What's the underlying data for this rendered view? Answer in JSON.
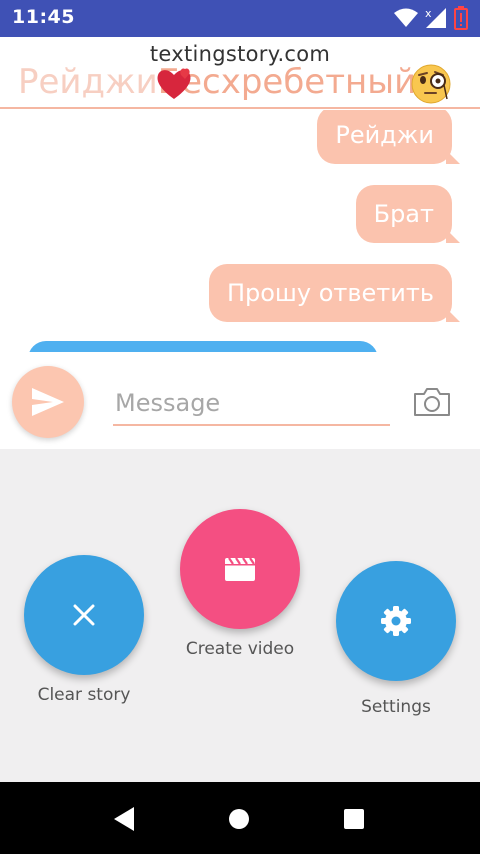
{
  "status_bar": {
    "time": "11:45"
  },
  "header": {
    "watermark": "textingstory.com",
    "name_part1": "Рейджи",
    "name_part2": "Бесхребетный"
  },
  "messages": [
    {
      "text": "Рейджи",
      "side": "right"
    },
    {
      "text": "Брат",
      "side": "right"
    },
    {
      "text": "Прошу ответить",
      "side": "right"
    }
  ],
  "composer": {
    "placeholder": "Message"
  },
  "controls": {
    "clear_label": "Clear story",
    "create_video_label": "Create video",
    "settings_label": "Settings"
  },
  "colors": {
    "status_bar": "#3f51b5",
    "accent_peach": "#fbc3ae",
    "blue": "#38a0e0",
    "pink": "#f44f82"
  },
  "icons": [
    "wifi-icon",
    "signal-icon",
    "battery-alert-icon",
    "heart-emoji-icon",
    "monocle-emoji-icon",
    "send-icon",
    "camera-icon",
    "close-icon",
    "clapperboard-icon",
    "gear-icon",
    "back-icon",
    "home-icon",
    "recents-icon"
  ]
}
